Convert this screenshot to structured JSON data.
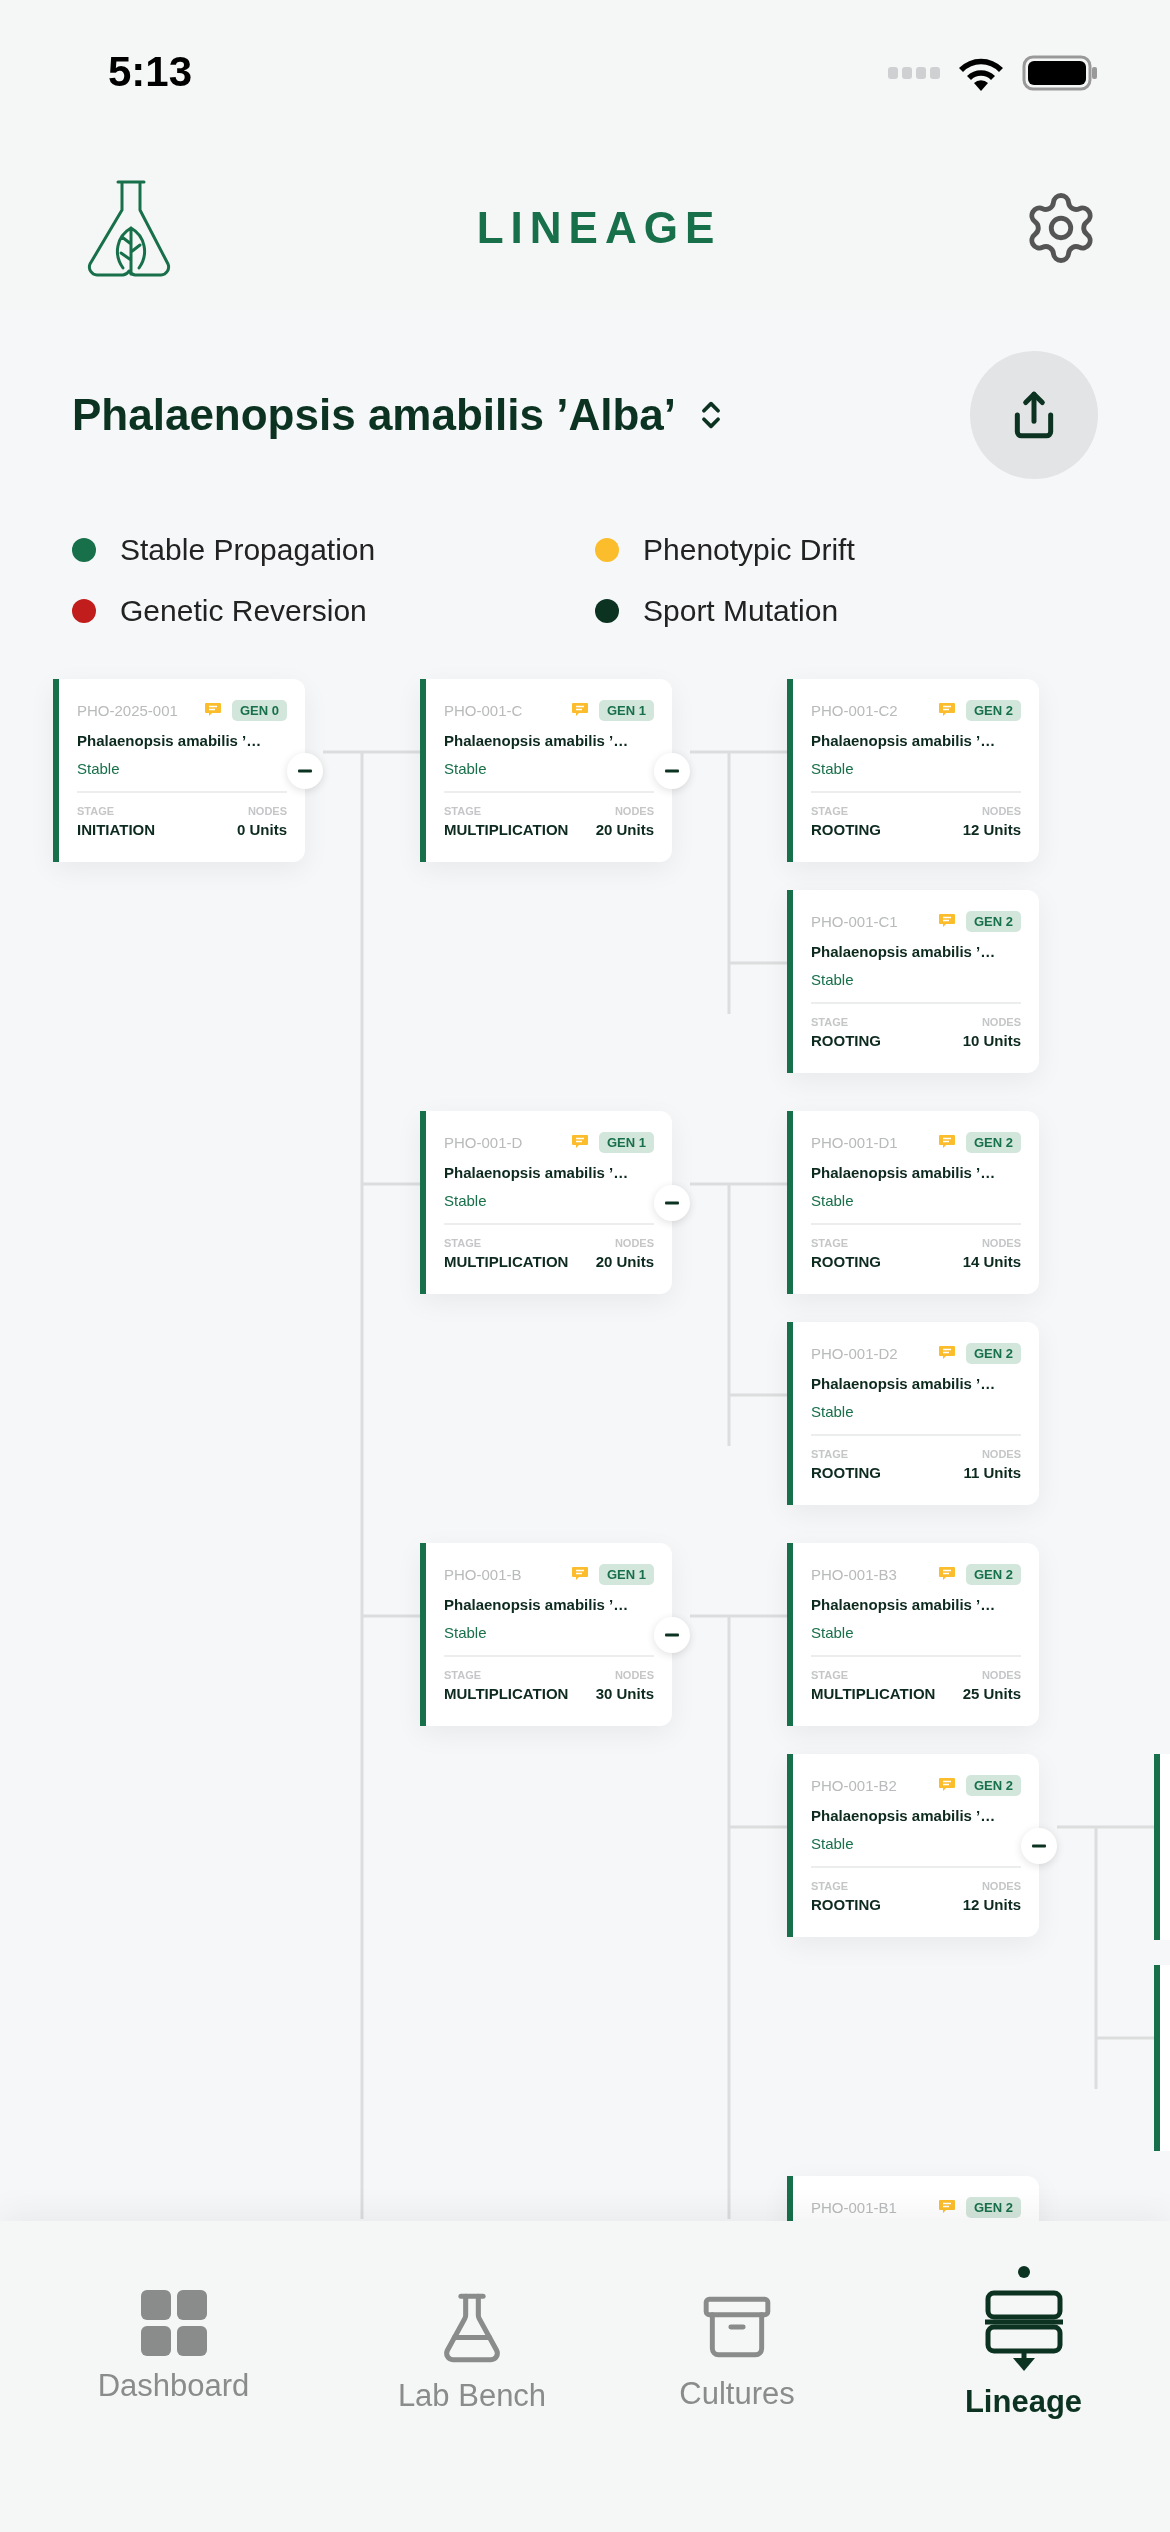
{
  "status_bar": {
    "time": "5:13"
  },
  "header": {
    "title": "LINEAGE"
  },
  "specimen": {
    "name": "Phalaenopsis amabilis ’Alba’"
  },
  "legend": [
    {
      "label": "Stable Propagation",
      "color": "#17704a"
    },
    {
      "label": "Phenotypic Drift",
      "color": "#fbbd2b"
    },
    {
      "label": "Genetic Reversion",
      "color": "#c21d1d"
    },
    {
      "label": "Sport Mutation",
      "color": "#0c3322"
    }
  ],
  "tree": {
    "kind": "card",
    "id": "PHO-2025-001",
    "gen": "GEN 0",
    "title": "Phalaenopsis amabilis ’…",
    "status": "Stable",
    "stage_label": "STAGE",
    "stage": "INITIATION",
    "nodes_label": "NODES",
    "nodes": "0 Units",
    "expanded": true,
    "children": [
      {
        "kind": "card",
        "id": "PHO-001-C",
        "gen": "GEN 1",
        "title": "Phalaenopsis amabilis ’…",
        "status": "Stable",
        "stage_label": "STAGE",
        "stage": "MULTIPLICATION",
        "nodes_label": "NODES",
        "nodes": "20 Units",
        "expanded": true,
        "children": [
          {
            "kind": "card",
            "id": "PHO-001-C2",
            "gen": "GEN 2",
            "title": "Phalaenopsis amabilis ’…",
            "status": "Stable",
            "stage_label": "STAGE",
            "stage": "ROOTING",
            "nodes_label": "NODES",
            "nodes": "12 Units"
          },
          {
            "kind": "card",
            "id": "PHO-001-C1",
            "gen": "GEN 2",
            "title": "Phalaenopsis amabilis ’…",
            "status": "Stable",
            "stage_label": "STAGE",
            "stage": "ROOTING",
            "nodes_label": "NODES",
            "nodes": "10 Units"
          }
        ]
      },
      {
        "kind": "card",
        "id": "PHO-001-D",
        "gen": "GEN 1",
        "title": "Phalaenopsis amabilis ’…",
        "status": "Stable",
        "stage_label": "STAGE",
        "stage": "MULTIPLICATION",
        "nodes_label": "NODES",
        "nodes": "20 Units",
        "expanded": true,
        "children": [
          {
            "kind": "card",
            "id": "PHO-001-D1",
            "gen": "GEN 2",
            "title": "Phalaenopsis amabilis ’…",
            "status": "Stable",
            "stage_label": "STAGE",
            "stage": "ROOTING",
            "nodes_label": "NODES",
            "nodes": "14 Units"
          },
          {
            "kind": "card",
            "id": "PHO-001-D2",
            "gen": "GEN 2",
            "title": "Phalaenopsis amabilis ’…",
            "status": "Stable",
            "stage_label": "STAGE",
            "stage": "ROOTING",
            "nodes_label": "NODES",
            "nodes": "11 Units"
          }
        ]
      },
      {
        "kind": "card",
        "id": "PHO-001-B",
        "gen": "GEN 1",
        "title": "Phalaenopsis amabilis ’…",
        "status": "Stable",
        "stage_label": "STAGE",
        "stage": "MULTIPLICATION",
        "nodes_label": "NODES",
        "nodes": "30 Units",
        "expanded": true,
        "children": [
          {
            "kind": "card",
            "id": "PHO-001-B3",
            "gen": "GEN 2",
            "title": "Phalaenopsis amabilis ’…",
            "status": "Stable",
            "stage_label": "STAGE",
            "stage": "MULTIPLICATION",
            "nodes_label": "NODES",
            "nodes": "25 Units"
          },
          {
            "kind": "card",
            "id": "PHO-001-B2",
            "gen": "GEN 2",
            "title": "Phalaenopsis amabilis ’…",
            "status": "Stable",
            "stage_label": "STAGE",
            "stage": "ROOTING",
            "nodes_label": "NODES",
            "nodes": "12 Units",
            "expanded": true,
            "children": [
              {
                "kind": "offscreen"
              },
              {
                "kind": "offscreen"
              }
            ]
          },
          {
            "kind": "card",
            "id": "PHO-001-B1",
            "gen": "GEN 2"
          }
        ]
      }
    ]
  },
  "nav": [
    {
      "label": "Dashboard",
      "kind": "grid",
      "selected": false
    },
    {
      "label": "Lab Bench",
      "kind": "flask",
      "selected": false
    },
    {
      "label": "Cultures",
      "kind": "archive",
      "selected": false
    },
    {
      "label": "Lineage",
      "kind": "lineage",
      "selected": true
    }
  ]
}
